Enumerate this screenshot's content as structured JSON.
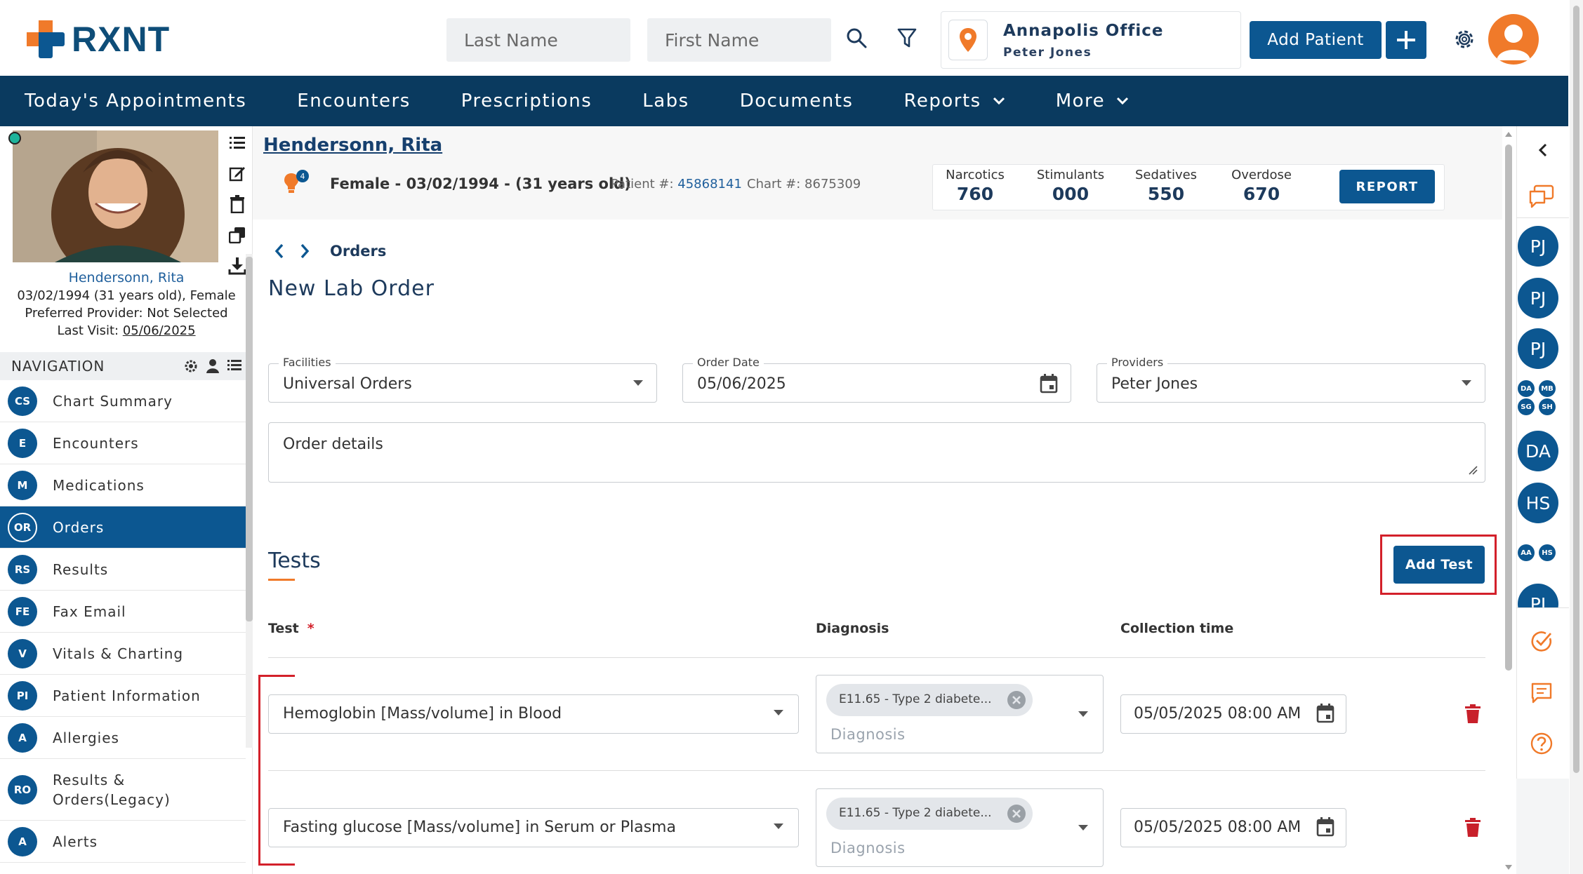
{
  "brand": {
    "name": "RXNT",
    "primary": "#0c5791",
    "navy": "#0a3a5f",
    "accent": "#f07a2a",
    "alert_red": "#d3202a"
  },
  "header": {
    "last_name_placeholder": "Last Name",
    "first_name_placeholder": "First Name",
    "office_name": "Annapolis Office",
    "office_user": "Peter Jones",
    "add_patient_label": "Add Patient"
  },
  "main_nav": [
    {
      "label": "Today's Appointments"
    },
    {
      "label": "Encounters"
    },
    {
      "label": "Prescriptions"
    },
    {
      "label": "Labs"
    },
    {
      "label": "Documents"
    },
    {
      "label": "Reports",
      "has_dropdown": true
    },
    {
      "label": "More",
      "has_dropdown": true
    }
  ],
  "patient_card": {
    "name": "Hendersonn, Rita",
    "dob_line": "03/02/1994 (31 years old), Female",
    "provider_line": "Preferred Provider: Not Selected",
    "last_visit_label": "Last Visit:",
    "last_visit_date": "05/06/2025"
  },
  "sidebar": {
    "title": "NAVIGATION",
    "items": [
      {
        "badge": "CS",
        "label": "Chart Summary"
      },
      {
        "badge": "E",
        "label": "Encounters"
      },
      {
        "badge": "M",
        "label": "Medications"
      },
      {
        "badge": "OR",
        "label": "Orders",
        "active": true
      },
      {
        "badge": "RS",
        "label": "Results"
      },
      {
        "badge": "FE",
        "label": "Fax Email"
      },
      {
        "badge": "V",
        "label": "Vitals & Charting"
      },
      {
        "badge": "PI",
        "label": "Patient Information"
      },
      {
        "badge": "A",
        "label": "Allergies"
      },
      {
        "badge": "RO",
        "label": "Results & Orders(Legacy)"
      },
      {
        "badge": "A",
        "label": "Alerts"
      }
    ]
  },
  "banner": {
    "name": "Hendersonn, Rita",
    "alert_count": "4",
    "demographics": "Female - 03/02/1994 - (31 years old)",
    "patient_num_label": "Patient #:",
    "patient_num": "45868141",
    "chart_num": "Chart #: 8675309",
    "pdmp": [
      {
        "label": "Narcotics",
        "value": "760"
      },
      {
        "label": "Stimulants",
        "value": "000"
      },
      {
        "label": "Sedatives",
        "value": "550"
      },
      {
        "label": "Overdose",
        "value": "670"
      }
    ],
    "report_label": "REPORT"
  },
  "breadcrumb": {
    "current": "Orders"
  },
  "page_title": "New Lab Order",
  "form": {
    "facilities": {
      "label": "Facilities",
      "value": "Universal Orders"
    },
    "order_date": {
      "label": "Order Date",
      "value": "05/06/2025"
    },
    "providers": {
      "label": "Providers",
      "value": "Peter Jones"
    },
    "order_details_placeholder": "Order details"
  },
  "tests": {
    "title": "Tests",
    "add_test_label": "Add Test",
    "columns": {
      "test": "Test",
      "required_mark": "*",
      "diagnosis": "Diagnosis",
      "collection_time": "Collection time"
    },
    "rows": [
      {
        "test": "Hemoglobin [Mass/volume] in Blood",
        "diagnosis_chip": "E11.65 - Type 2 diabete...",
        "diagnosis_placeholder": "Diagnosis",
        "collection_time": "05/05/2025 08:00 AM"
      },
      {
        "test": "Fasting glucose [Mass/volume] in Serum or Plasma",
        "diagnosis_chip": "E11.65 - Type 2 diabete...",
        "diagnosis_placeholder": "Diagnosis",
        "collection_time": "05/05/2025 08:00 AM"
      }
    ]
  },
  "right_rail": {
    "avatars_big": [
      "PJ",
      "PJ",
      "PJ",
      "DA",
      "HS",
      "PJ"
    ],
    "avatars_group1": [
      "DA",
      "MB",
      "SG",
      "SH"
    ],
    "avatars_group2": [
      "AA",
      "HS"
    ]
  }
}
